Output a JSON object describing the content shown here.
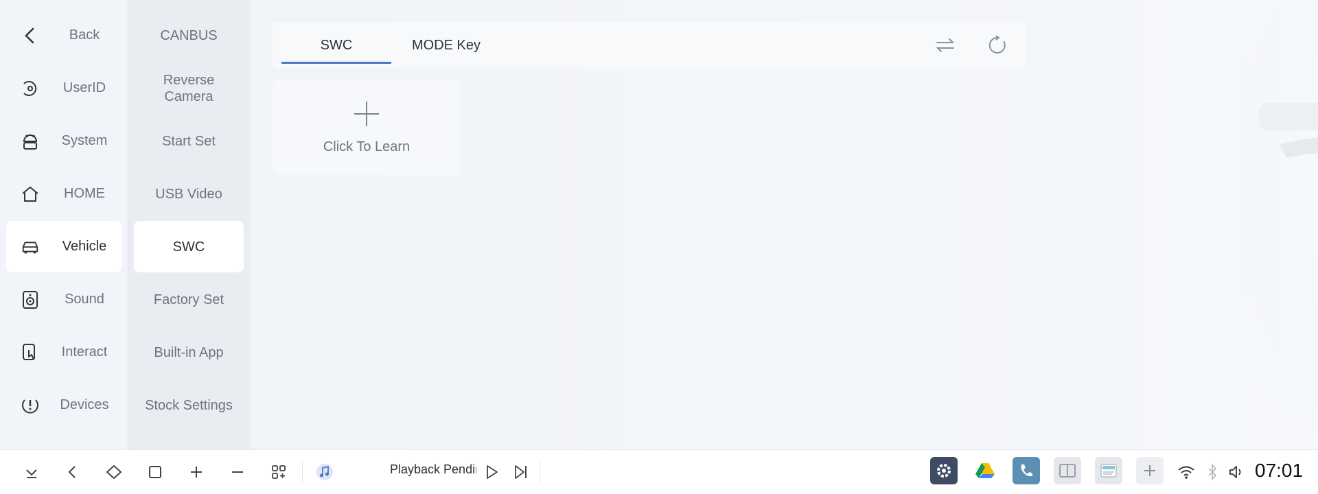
{
  "nav": {
    "items": [
      {
        "label": "Back",
        "icon": "back-icon"
      },
      {
        "label": "UserID",
        "icon": "userid-icon"
      },
      {
        "label": "System",
        "icon": "android-icon"
      },
      {
        "label": "HOME",
        "icon": "home-icon"
      },
      {
        "label": "Vehicle",
        "icon": "car-icon",
        "active": true
      },
      {
        "label": "Sound",
        "icon": "speaker-icon"
      },
      {
        "label": "Interact",
        "icon": "touch-icon"
      },
      {
        "label": "Devices",
        "icon": "alert-icon"
      }
    ]
  },
  "subnav": {
    "items": [
      {
        "label": "CANBUS"
      },
      {
        "label": "Reverse\nCamera"
      },
      {
        "label": "Start Set"
      },
      {
        "label": "USB Video"
      },
      {
        "label": "SWC",
        "active": true
      },
      {
        "label": "Factory Set"
      },
      {
        "label": "Built-in App"
      },
      {
        "label": "Stock Settings"
      }
    ]
  },
  "tabs": {
    "items": [
      {
        "label": "SWC",
        "active": true
      },
      {
        "label": "MODE Key"
      }
    ],
    "swap_icon": "swap-icon",
    "reset_icon": "reset-icon"
  },
  "learn": {
    "label": "Click To Learn",
    "icon": "plus-icon"
  },
  "taskbar": {
    "now_playing": "Playback Pending",
    "clock": "07:01",
    "accent": "#4f74c8"
  }
}
